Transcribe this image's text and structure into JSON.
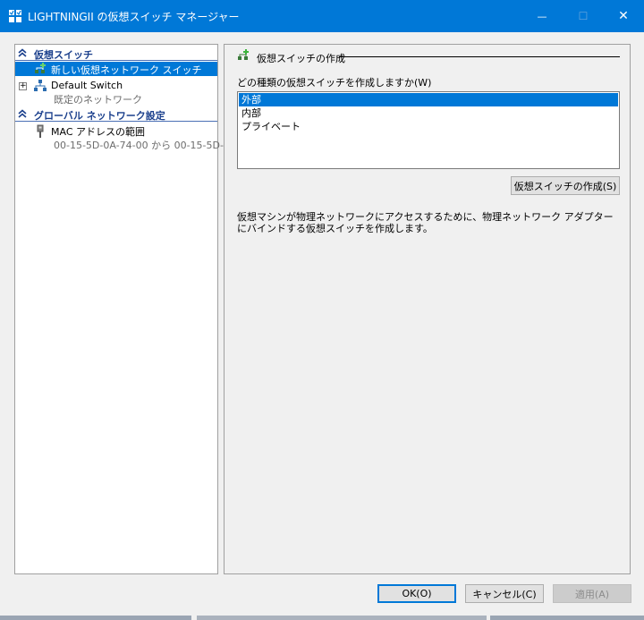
{
  "window": {
    "title": "LIGHTNINGII の仮想スイッチ マネージャー",
    "minimize_glyph": "—",
    "maximize_glyph": "☐",
    "close_glyph": "✕",
    "titlebar_color": "#0078d7"
  },
  "sidebar": {
    "section_virtual_switches": "仮想スイッチ",
    "new_switch_label": "新しい仮想ネットワーク スイッチ",
    "default_switch": {
      "expander": "+",
      "name": "Default Switch",
      "subtitle": "既定のネットワーク"
    },
    "section_global": "グローバル ネットワーク設定",
    "mac_range": {
      "name": "MAC アドレスの範囲",
      "value": "00-15-5D-0A-74-00 から 00-15-5D-..."
    },
    "section_chevron": "⌃"
  },
  "main": {
    "group_title": "仮想スイッチの作成",
    "question": "どの種類の仮想スイッチを作成しますか(W)",
    "switch_types": [
      "外部",
      "内部",
      "プライベート"
    ],
    "selected_index": 0,
    "create_button": "仮想スイッチの作成(S)",
    "description": "仮想マシンが物理ネットワークにアクセスするために、物理ネットワーク アダプターにバインドする仮想スイッチを作成します。"
  },
  "footer": {
    "ok": "OK(O)",
    "cancel": "キャンセル(C)",
    "apply": "適用(A)"
  },
  "icons": {
    "app": "virtual-switch-manager-icon",
    "new_switch": "network-add-icon",
    "default_switch": "network-switch-icon",
    "mac": "network-cable-icon",
    "create_group": "network-add-icon"
  }
}
